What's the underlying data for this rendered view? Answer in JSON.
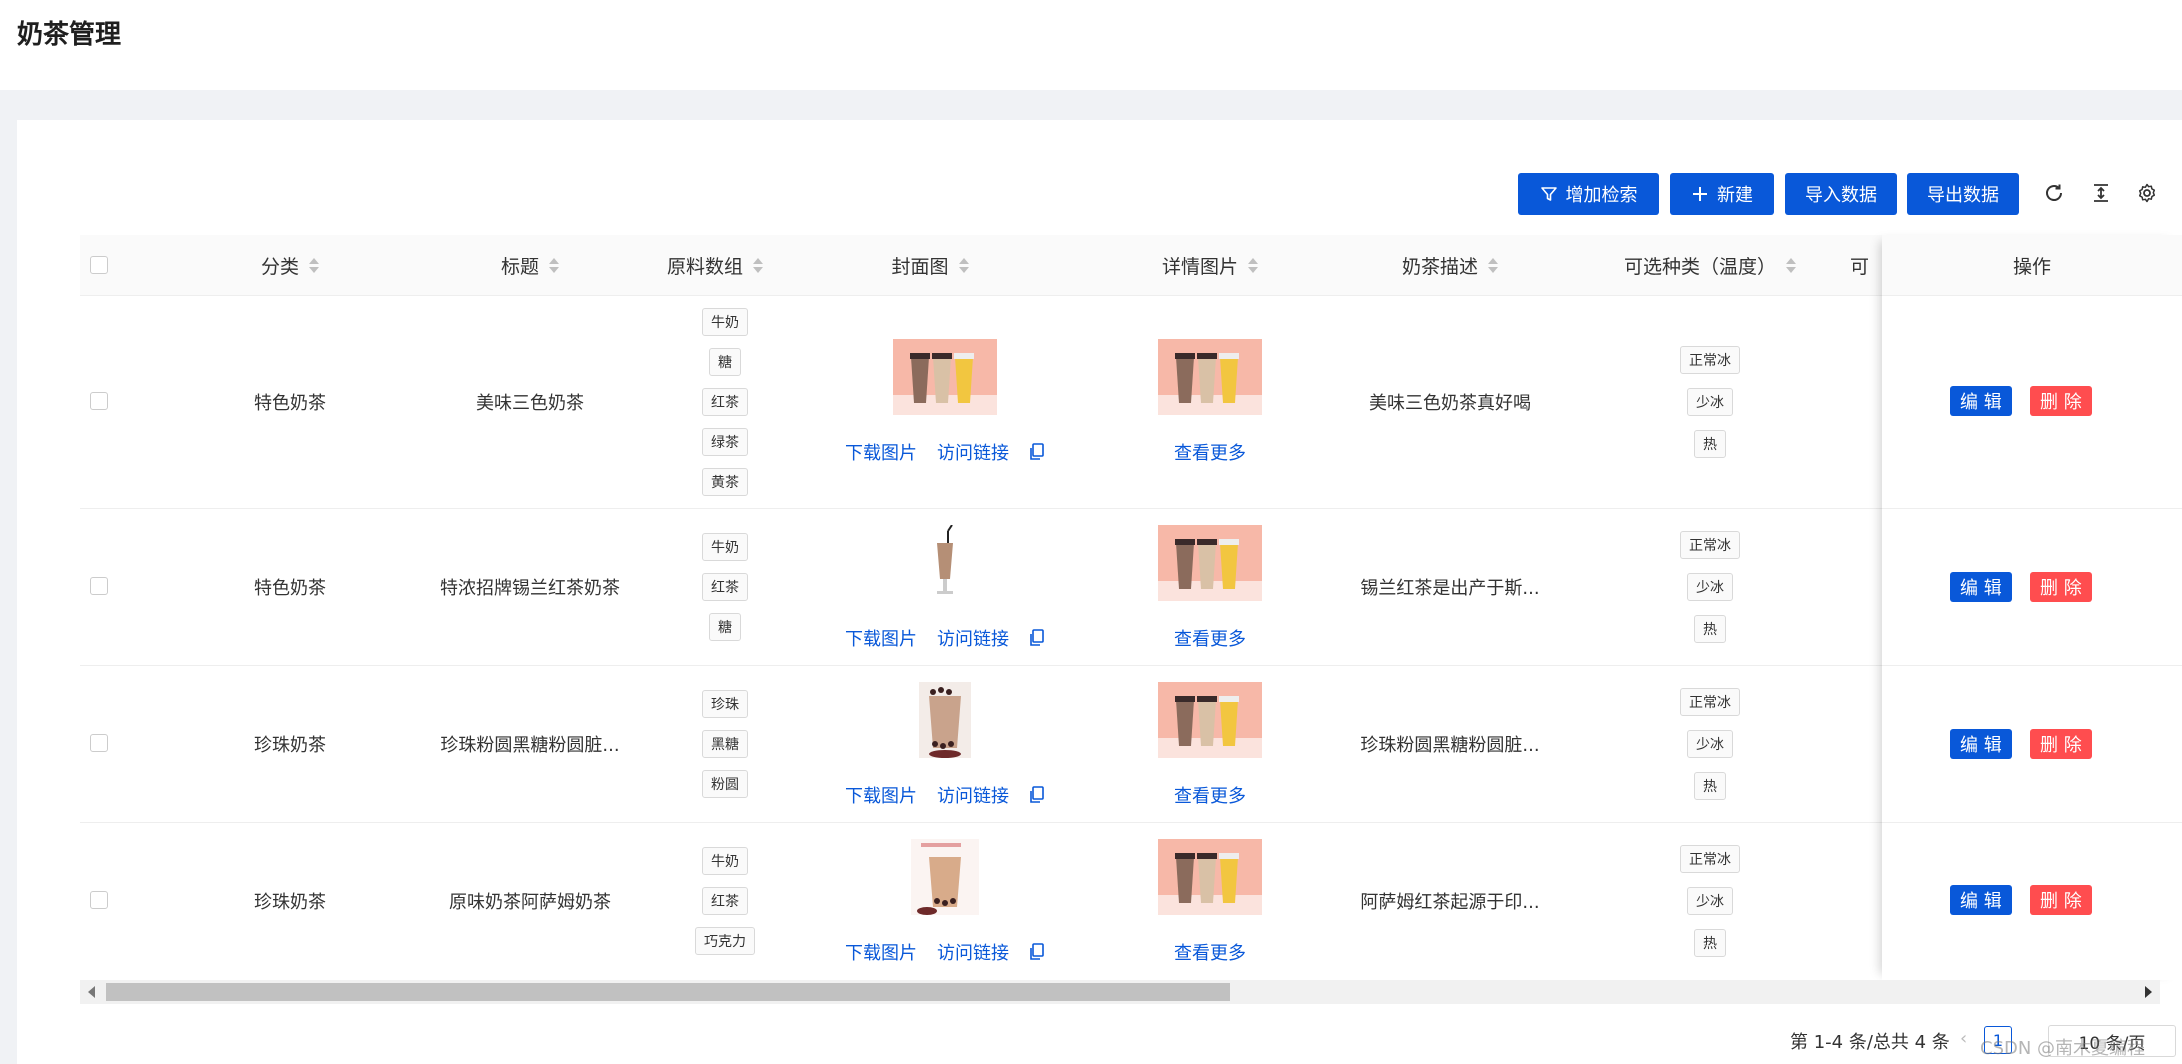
{
  "page": {
    "title": "奶茶管理"
  },
  "toolbar": {
    "search_label": "增加检索",
    "new_label": "新建",
    "import_label": "导入数据",
    "export_label": "导出数据"
  },
  "table": {
    "columns": [
      "分类",
      "标题",
      "原料数组",
      "封面图",
      "详情图片",
      "奶茶描述",
      "可选种类（温度）",
      "可",
      "操作"
    ],
    "rows": [
      {
        "category": "特色奶茶",
        "title": "美味三色奶茶",
        "ingredients": [
          "牛奶",
          "糖",
          "红茶",
          "绿茶",
          "黄茶"
        ],
        "download": "下载图片",
        "visit": "访问链接",
        "more": "查看更多",
        "desc": "美味三色奶茶真好喝",
        "temps": [
          "正常冰",
          "少冰",
          "热"
        ],
        "edit": "编 辑",
        "delete": "删 除"
      },
      {
        "category": "特色奶茶",
        "title": "特浓招牌锡兰红茶奶茶",
        "ingredients": [
          "牛奶",
          "红茶",
          "糖"
        ],
        "download": "下载图片",
        "visit": "访问链接",
        "more": "查看更多",
        "desc": "锡兰红茶是出产于斯...",
        "temps": [
          "正常冰",
          "少冰",
          "热"
        ],
        "edit": "编 辑",
        "delete": "删 除"
      },
      {
        "category": "珍珠奶茶",
        "title": "珍珠粉圆黑糖粉圆脏...",
        "ingredients": [
          "珍珠",
          "黑糖",
          "粉圆"
        ],
        "download": "下载图片",
        "visit": "访问链接",
        "more": "查看更多",
        "desc": "珍珠粉圆黑糖粉圆脏...",
        "temps": [
          "正常冰",
          "少冰",
          "热"
        ],
        "edit": "编 辑",
        "delete": "删 除"
      },
      {
        "category": "珍珠奶茶",
        "title": "原味奶茶阿萨姆奶茶",
        "ingredients": [
          "牛奶",
          "红茶",
          "巧克力"
        ],
        "download": "下载图片",
        "visit": "访问链接",
        "more": "查看更多",
        "desc": "阿萨姆红茶起源于印...",
        "temps": [
          "正常冰",
          "少冰",
          "热"
        ],
        "edit": "编 辑",
        "delete": "删 除"
      }
    ]
  },
  "pagination": {
    "summary": "第 1-4 条/总共 4 条",
    "current": "1",
    "page_size": "10 条/页"
  },
  "watermark": "CSDN @南木夏编程",
  "colors": {
    "primary": "#0958d9",
    "danger": "#ff4d4f"
  }
}
